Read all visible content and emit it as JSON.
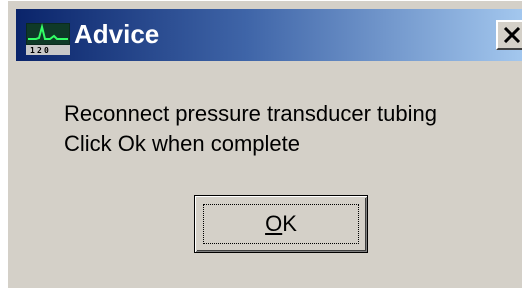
{
  "window": {
    "title": "Advice",
    "close_icon": "close-icon",
    "app_icon": "waveform-app-icon"
  },
  "message": {
    "line1": "Reconnect pressure transducer tubing",
    "line2": "Click Ok when complete"
  },
  "buttons": {
    "ok_mnemonic": "O",
    "ok_rest": "K"
  },
  "colors": {
    "title_gradient_start": "#0a246a",
    "title_gradient_end": "#a6caf0",
    "dialog_face": "#d4d0c8"
  }
}
